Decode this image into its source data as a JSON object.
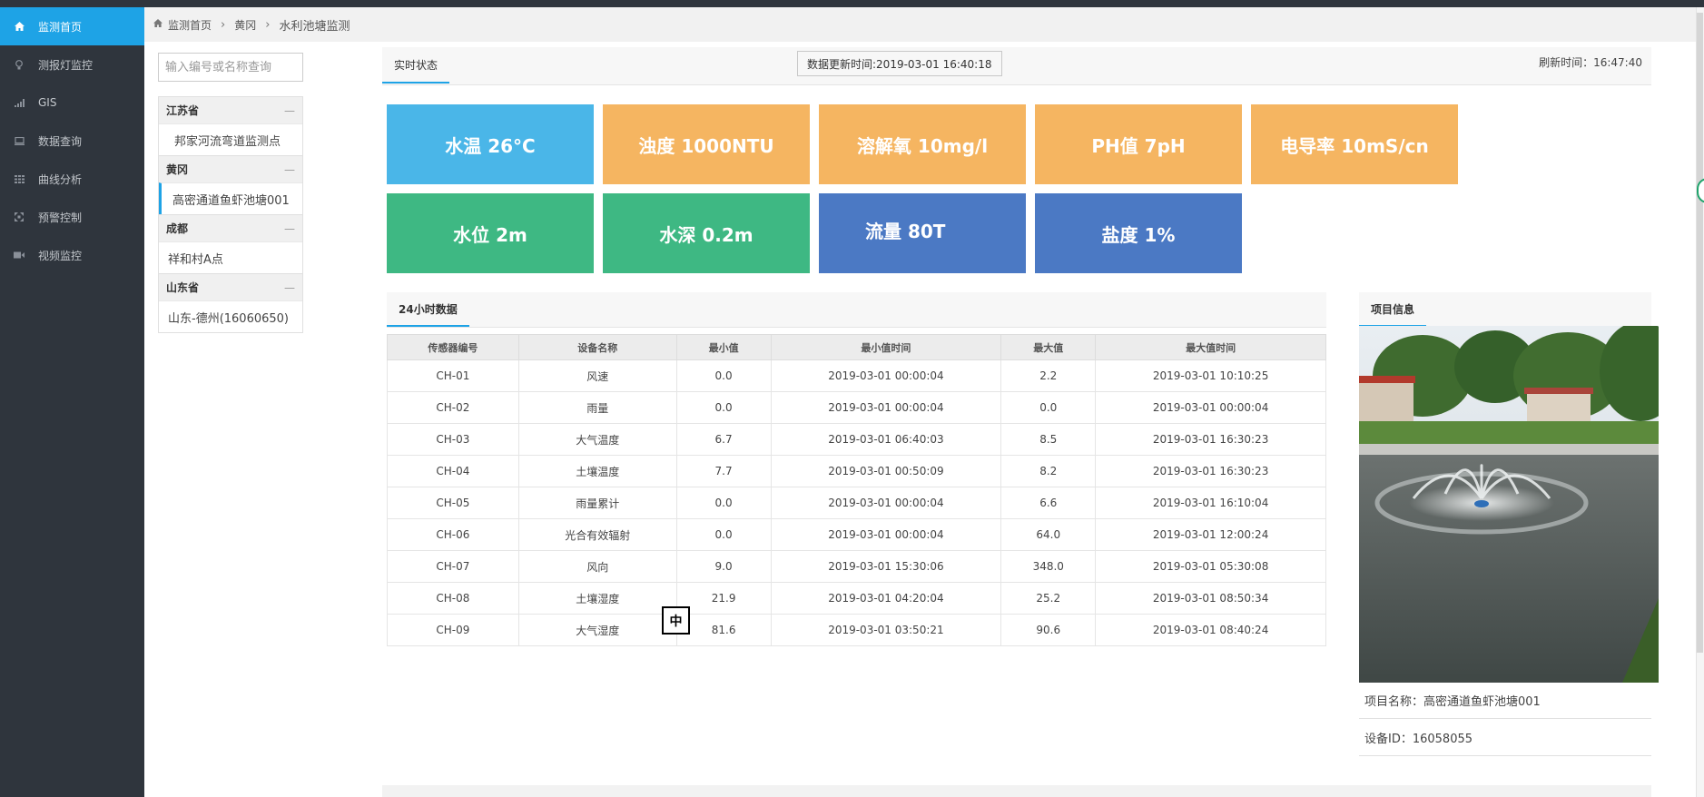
{
  "sidebar": {
    "items": [
      {
        "label": "监测首页",
        "icon": "home-icon"
      },
      {
        "label": "测报灯监控",
        "icon": "bulb-icon"
      },
      {
        "label": "GIS",
        "icon": "signal-icon"
      },
      {
        "label": "数据查询",
        "icon": "monitor-icon"
      },
      {
        "label": "曲线分析",
        "icon": "grid-icon"
      },
      {
        "label": "预警控制",
        "icon": "expand-icon"
      },
      {
        "label": "视频监控",
        "icon": "camera-icon"
      }
    ]
  },
  "breadcrumb": {
    "home": "监测首页",
    "level2": "黄冈",
    "current": "水利池塘监测"
  },
  "tree": {
    "search_placeholder": "输入编号或名称查询",
    "groups": [
      {
        "province": "江苏省",
        "toggle": "—",
        "points": [
          "邦家河流弯道监测点"
        ]
      },
      {
        "province": "黄冈",
        "toggle": "—",
        "points": [
          "高密通道鱼虾池塘001"
        ]
      },
      {
        "province": "成都",
        "toggle": "—",
        "points": [
          "祥和村A点"
        ]
      },
      {
        "province": "山东省",
        "toggle": "—",
        "points": [
          "山东-德州(16060650)"
        ]
      }
    ]
  },
  "status": {
    "tab": "实时状态",
    "update_time": "数据更新时间:2019-03-01 16:40:18",
    "refresh_time": "刷新时间：16:47:40"
  },
  "tiles": [
    {
      "label": "水温 26°C",
      "color": "#4ab6e8"
    },
    {
      "label": "浊度 1000NTU",
      "color": "#f5b561"
    },
    {
      "label": "溶解氧 10mg/l",
      "color": "#f5b561"
    },
    {
      "label": "PH值 7pH",
      "color": "#f5b561"
    },
    {
      "label": "电导率 10mS/cn",
      "color": "#f5b561"
    },
    {
      "label": "水位 2m",
      "color": "#3eb883"
    },
    {
      "label": "水深 0.2m",
      "color": "#3eb883"
    },
    {
      "label": "流量 80T",
      "color": "#4b79c4"
    },
    {
      "label": "盐度 1%",
      "color": "#4b79c4"
    }
  ],
  "table24": {
    "tab": "24小时数据",
    "headers": [
      "传感器编号",
      "设备名称",
      "最小值",
      "最小值时间",
      "最大值",
      "最大值时间"
    ],
    "rows": [
      [
        "CH-01",
        "风速",
        "0.0",
        "2019-03-01 00:00:04",
        "2.2",
        "2019-03-01 10:10:25"
      ],
      [
        "CH-02",
        "雨量",
        "0.0",
        "2019-03-01 00:00:04",
        "0.0",
        "2019-03-01 00:00:04"
      ],
      [
        "CH-03",
        "大气温度",
        "6.7",
        "2019-03-01 06:40:03",
        "8.5",
        "2019-03-01 16:30:23"
      ],
      [
        "CH-04",
        "土壤温度",
        "7.7",
        "2019-03-01 00:50:09",
        "8.2",
        "2019-03-01 16:30:23"
      ],
      [
        "CH-05",
        "雨量累计",
        "0.0",
        "2019-03-01 00:00:04",
        "6.6",
        "2019-03-01 16:10:04"
      ],
      [
        "CH-06",
        "光合有效辐射",
        "0.0",
        "2019-03-01 00:00:04",
        "64.0",
        "2019-03-01 12:00:24"
      ],
      [
        "CH-07",
        "风向",
        "9.0",
        "2019-03-01 15:30:06",
        "348.0",
        "2019-03-01 05:30:08"
      ],
      [
        "CH-08",
        "土壤湿度",
        "21.9",
        "2019-03-01 04:20:04",
        "25.2",
        "2019-03-01 08:50:34"
      ],
      [
        "CH-09",
        "大气湿度",
        "81.6",
        "2019-03-01 03:50:21",
        "90.6",
        "2019-03-01 08:40:24"
      ]
    ]
  },
  "project": {
    "tab": "项目信息",
    "name_line": "项目名称：高密通道鱼虾池塘001",
    "device_line": "设备ID：16058055"
  },
  "ime_indicator": "中"
}
